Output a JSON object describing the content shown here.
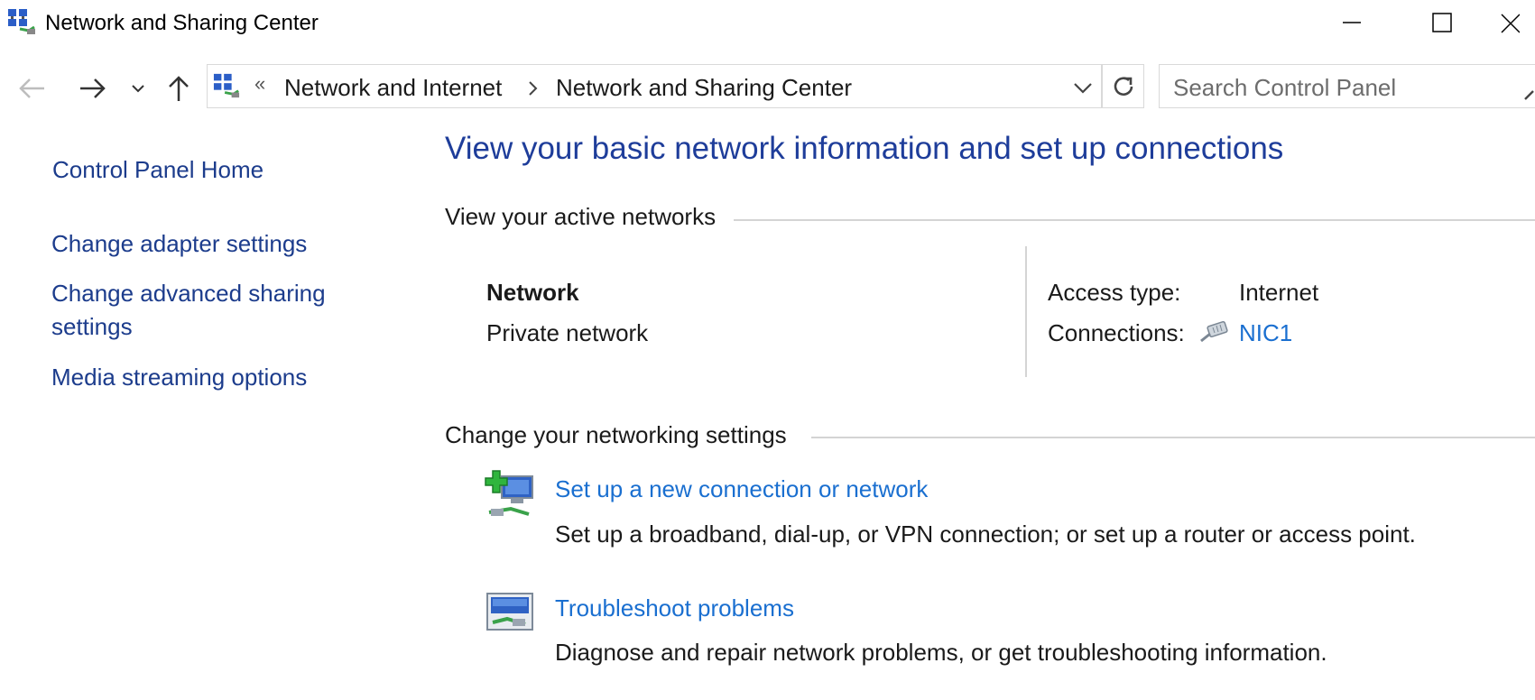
{
  "window": {
    "title": "Network and Sharing Center",
    "icon": "network-icon"
  },
  "navigation": {
    "breadcrumb_overflow": "«",
    "breadcrumbs": [
      "Network and Internet",
      "Network and Sharing Center"
    ],
    "search_placeholder": "Search Control Panel"
  },
  "sidebar": {
    "home": "Control Panel Home",
    "links": [
      "Change adapter settings",
      "Change advanced sharing\nsettings",
      "Media streaming options"
    ],
    "link_line1": "Change advanced sharing",
    "link_line2": "settings"
  },
  "main": {
    "title": "View your basic network information and set up connections",
    "active_networks_heading": "View your active networks",
    "network": {
      "name": "Network",
      "category": "Private network",
      "access_type_label": "Access type:",
      "access_type_value": "Internet",
      "connections_label": "Connections:",
      "connections_value": "NIC1"
    },
    "change_settings_heading": "Change your networking settings",
    "tasks": [
      {
        "title": "Set up a new connection or network",
        "description": "Set up a broadband, dial-up, or VPN connection; or set up a router or access point.",
        "icon": "new-connection-icon"
      },
      {
        "title": "Troubleshoot problems",
        "description": "Diagnose and repair network problems, or get troubleshooting information.",
        "icon": "troubleshoot-icon"
      }
    ]
  },
  "colors": {
    "title_blue": "#1e3d9a",
    "nav_link": "#1c3c8c",
    "task_link": "#1a6fd0",
    "rule": "#d4d4d4"
  }
}
